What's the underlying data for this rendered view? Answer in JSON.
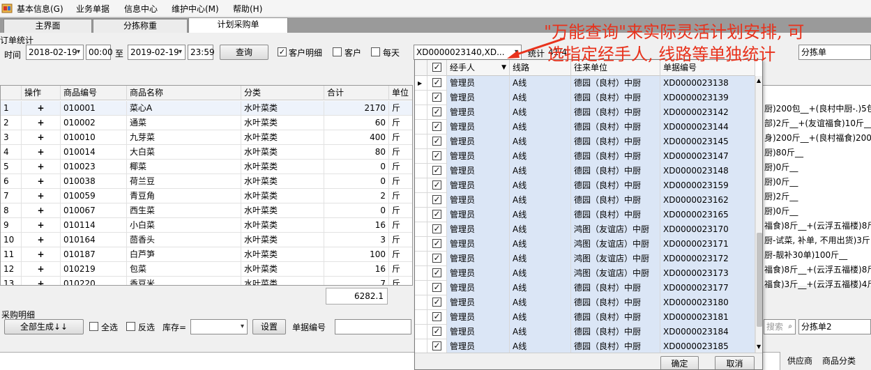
{
  "menu": [
    "基本信息(G)",
    "业务单据",
    "信息中心",
    "维护中心(M)",
    "帮助(H)"
  ],
  "tabs": [
    "主界面",
    "分拣称重",
    "计划采购单"
  ],
  "order_stats_label": "订单统计",
  "toolbar": {
    "time_label": "时间",
    "date_from": "2018-02-19",
    "time_from": "00:00",
    "to_label": "至",
    "date_to": "2019-02-19",
    "time_to": "23:59",
    "query_button": "查询",
    "customer_detail_label": "客户明细",
    "customer_label": "客户",
    "daily_label": "每天",
    "order_combo": "XD0000023140,XD...",
    "stats_label": "统计",
    "stats_count": "41/4",
    "sort_label": "分拣单"
  },
  "annotation": {
    "line1": "\"万能查询\"来实际灵活计划安排, 可",
    "line2": "选指定经手人, 线路等单独统计"
  },
  "grid": {
    "headers": [
      "操作",
      "商品编号",
      "商品名称",
      "分类",
      "合计",
      "单位"
    ],
    "rows": [
      {
        "no": "1",
        "op": "+",
        "code": "010001",
        "name": "菜心A",
        "cat": "水叶菜类",
        "total": "2170",
        "unit": "斤"
      },
      {
        "no": "2",
        "op": "+",
        "code": "010002",
        "name": "通菜",
        "cat": "水叶菜类",
        "total": "60",
        "unit": "斤"
      },
      {
        "no": "3",
        "op": "+",
        "code": "010010",
        "name": "九芽菜",
        "cat": "水叶菜类",
        "total": "400",
        "unit": "斤"
      },
      {
        "no": "4",
        "op": "+",
        "code": "010014",
        "name": "大白菜",
        "cat": "水叶菜类",
        "total": "80",
        "unit": "斤"
      },
      {
        "no": "5",
        "op": "+",
        "code": "010023",
        "name": "椰菜",
        "cat": "水叶菜类",
        "total": "0",
        "unit": "斤"
      },
      {
        "no": "6",
        "op": "+",
        "code": "010038",
        "name": "荷兰豆",
        "cat": "水叶菜类",
        "total": "0",
        "unit": "斤"
      },
      {
        "no": "7",
        "op": "+",
        "code": "010059",
        "name": "青豆角",
        "cat": "水叶菜类",
        "total": "2",
        "unit": "斤"
      },
      {
        "no": "8",
        "op": "+",
        "code": "010067",
        "name": "西生菜",
        "cat": "水叶菜类",
        "total": "0",
        "unit": "斤"
      },
      {
        "no": "9",
        "op": "+",
        "code": "010114",
        "name": "小白菜",
        "cat": "水叶菜类",
        "total": "16",
        "unit": "斤"
      },
      {
        "no": "10",
        "op": "+",
        "code": "010164",
        "name": "茴香头",
        "cat": "水叶菜类",
        "total": "3",
        "unit": "斤"
      },
      {
        "no": "11",
        "op": "+",
        "code": "010187",
        "name": "白芦笋",
        "cat": "水叶菜类",
        "total": "100",
        "unit": "斤"
      },
      {
        "no": "12",
        "op": "+",
        "code": "010219",
        "name": "包菜",
        "cat": "水叶菜类",
        "total": "16",
        "unit": "斤"
      },
      {
        "no": "13",
        "op": "+",
        "code": "010220",
        "name": "香豆米",
        "cat": "水叶菜类",
        "total": "7",
        "unit": "斤"
      }
    ],
    "sum_total": "6282.1"
  },
  "right_notes": [
    "厨)200包__+(良村中厨-.)5包",
    "部)2斤__+(友谊福食)10斤__",
    "身)200斤__+(良村福食)200F",
    "厨)80斤__",
    "厨)0斤__",
    "厨)0斤__",
    "厨)2斤__",
    "厨)0斤__",
    "福食)8斤__+(云浮五福楼)8斤",
    "厨-试菜, 补单, 不用出货)3斤",
    "厨-靓补30单)100斤__",
    "福食)8斤__+(云浮五福楼)8斤",
    "福食)3斤__+(云浮五福楼)4斤"
  ],
  "dropdown": {
    "headers": [
      "经手人",
      "线路",
      "往来单位",
      "单据编号"
    ],
    "rows": [
      {
        "handler": "管理员",
        "route": "A线",
        "unit": "德园（良村）中厨",
        "doc": "XD0000023138"
      },
      {
        "handler": "管理员",
        "route": "A线",
        "unit": "德园（良村）中厨",
        "doc": "XD0000023139"
      },
      {
        "handler": "管理员",
        "route": "A线",
        "unit": "德园（良村）中厨",
        "doc": "XD0000023142"
      },
      {
        "handler": "管理员",
        "route": "A线",
        "unit": "德园（良村）中厨",
        "doc": "XD0000023144"
      },
      {
        "handler": "管理员",
        "route": "A线",
        "unit": "德园（良村）中厨",
        "doc": "XD0000023145"
      },
      {
        "handler": "管理员",
        "route": "A线",
        "unit": "德园（良村）中厨",
        "doc": "XD0000023147"
      },
      {
        "handler": "管理员",
        "route": "A线",
        "unit": "德园（良村）中厨",
        "doc": "XD0000023148"
      },
      {
        "handler": "管理员",
        "route": "A线",
        "unit": "德园（良村）中厨",
        "doc": "XD0000023159"
      },
      {
        "handler": "管理员",
        "route": "A线",
        "unit": "德园（良村）中厨",
        "doc": "XD0000023162"
      },
      {
        "handler": "管理员",
        "route": "A线",
        "unit": "德园（良村）中厨",
        "doc": "XD0000023165"
      },
      {
        "handler": "管理员",
        "route": "A线",
        "unit": "鸿图（友谊店）中厨",
        "doc": "XD0000023170"
      },
      {
        "handler": "管理员",
        "route": "A线",
        "unit": "鸿图（友谊店）中厨",
        "doc": "XD0000023171"
      },
      {
        "handler": "管理员",
        "route": "A线",
        "unit": "鸿图（友谊店）中厨",
        "doc": "XD0000023172"
      },
      {
        "handler": "管理员",
        "route": "A线",
        "unit": "鸿图（友谊店）中厨",
        "doc": "XD0000023173"
      },
      {
        "handler": "管理员",
        "route": "A线",
        "unit": "德园（良村）中厨",
        "doc": "XD0000023177"
      },
      {
        "handler": "管理员",
        "route": "A线",
        "unit": "德园（良村）中厨",
        "doc": "XD0000023180"
      },
      {
        "handler": "管理员",
        "route": "A线",
        "unit": "德园（良村）中厨",
        "doc": "XD0000023181"
      },
      {
        "handler": "管理员",
        "route": "A线",
        "unit": "德园（良村）中厨",
        "doc": "XD0000023184"
      },
      {
        "handler": "管理员",
        "route": "A线",
        "unit": "德园（良村）中厨",
        "doc": "XD0000023185"
      }
    ],
    "ok_button": "确定",
    "cancel_button": "取消"
  },
  "purchase": {
    "section_label": "采购明细",
    "generate_button": "全部生成↓↓",
    "select_all": "全选",
    "invert": "反选",
    "stock_label": "库存=",
    "settings_button": "设置",
    "doc_no_label": "单据编号",
    "search_placeholder": "搜索",
    "sort_sheet": "分拣单2",
    "supplier_tab": "供应商",
    "category_tab": "商品分类"
  }
}
